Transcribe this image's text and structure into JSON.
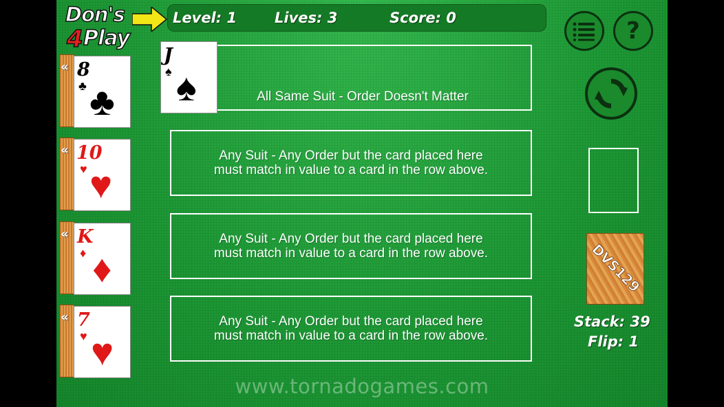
{
  "header": {
    "logo_line1": "Don's",
    "logo_four": "4",
    "logo_line2": "Play",
    "level_label": "Level: 1",
    "lives_label": "Lives: 3",
    "score_label": "Score: 0"
  },
  "buttons": {
    "menu_icon": "menu-icon",
    "help_icon": "help-icon",
    "help_glyph": "?",
    "refresh_icon": "refresh-icon"
  },
  "hand": [
    {
      "rank": "8",
      "suit": "♣",
      "color": "black"
    },
    {
      "rank": "10",
      "suit": "♥",
      "color": "red"
    },
    {
      "rank": "K",
      "suit": "♦",
      "color": "red"
    },
    {
      "rank": "7",
      "suit": "♥",
      "color": "red"
    }
  ],
  "chevron": "«",
  "rows": [
    {
      "placed_card": {
        "rank": "J",
        "suit": "♠",
        "color": "black"
      },
      "rule": "All Same Suit - Order Doesn't Matter"
    },
    {
      "rule_line1": "Any Suit - Any Order but the card placed here",
      "rule_line2": "must match in value to a card in the row above."
    },
    {
      "rule_line1": "Any Suit - Any Order but the card placed here",
      "rule_line2": "must match in value to a card in the row above."
    },
    {
      "rule_line1": "Any Suit - Any Order but the card placed here",
      "rule_line2": "must match in value to a card in the row above."
    }
  ],
  "side": {
    "deck_text": "DVS129",
    "stack_label": "Stack: 39",
    "flip_label": "Flip: 1"
  },
  "watermark": "www.tornadogames.com",
  "colors": {
    "felt": "#1fa23a",
    "status_bar": "#157a25",
    "card_red": "#e01818",
    "deck_orange": "#d88a3a"
  }
}
